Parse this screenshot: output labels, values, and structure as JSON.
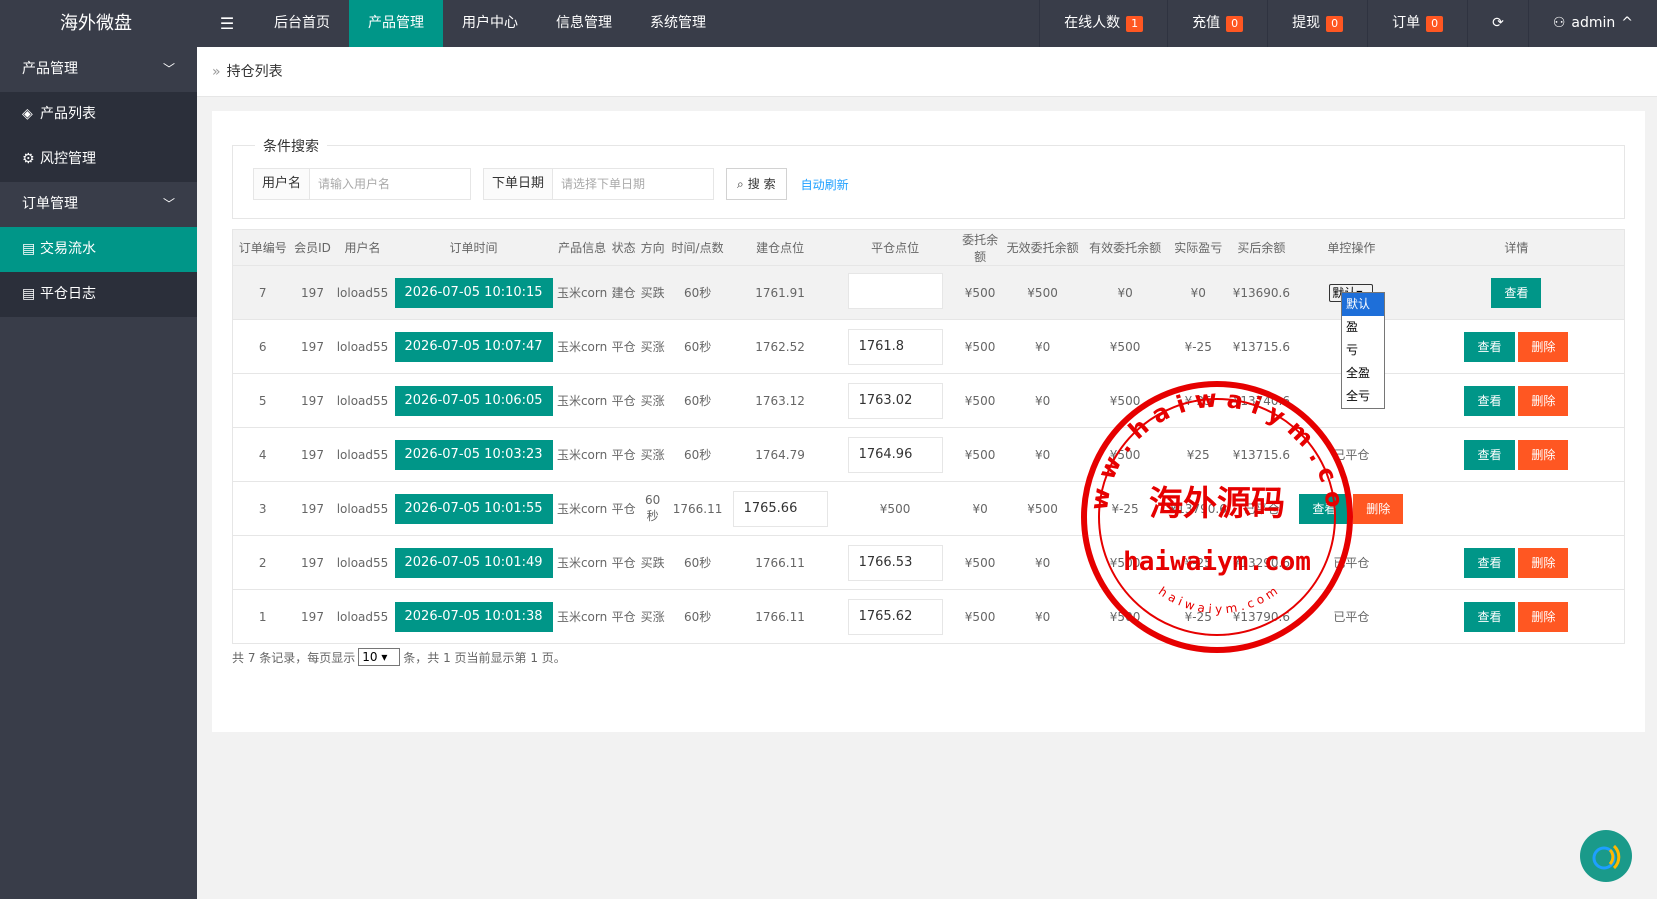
{
  "app": {
    "logo": "海外微盘",
    "menu_toggle_icon": "menu-icon"
  },
  "topnav": {
    "items": [
      {
        "label": "后台首页",
        "active": false
      },
      {
        "label": "产品管理",
        "active": true
      },
      {
        "label": "用户中心",
        "active": false
      },
      {
        "label": "信息管理",
        "active": false
      },
      {
        "label": "系统管理",
        "active": false
      }
    ]
  },
  "topright": {
    "online_label": "在线人数",
    "online_count": "1",
    "recharge_label": "充值",
    "recharge_count": "0",
    "withdraw_label": "提现",
    "withdraw_count": "0",
    "order_label": "订单",
    "order_count": "0",
    "user": "admin"
  },
  "sidebar": {
    "group1": "产品管理",
    "items1": [
      {
        "label": "产品列表",
        "icon": "layers-icon"
      },
      {
        "label": "风控管理",
        "icon": "gear-icon"
      }
    ],
    "group2": "订单管理",
    "items2": [
      {
        "label": "交易流水",
        "icon": "clipboard-icon",
        "active": true
      },
      {
        "label": "平仓日志",
        "icon": "clipboard-icon",
        "active": false
      }
    ]
  },
  "breadcrumb": {
    "label": "持仓列表"
  },
  "search": {
    "legend": "条件搜索",
    "username_label": "用户名",
    "username_placeholder": "请输入用户名",
    "date_label": "下单日期",
    "date_placeholder": "请选择下单日期",
    "search_button": "搜 索",
    "auto_refresh": "自动刷新"
  },
  "table": {
    "headers": [
      "订单编号",
      "会员ID",
      "用户名",
      "订单时间",
      "产品信息",
      "状态",
      "方向",
      "时间/点数",
      "建仓点位",
      "平仓点位",
      "委托余额",
      "无效委托余额",
      "有效委托余额",
      "实际盈亏",
      "买后余额",
      "单控操作",
      "详情"
    ],
    "rows": [
      {
        "id": "7",
        "member": "197",
        "user": "loload55",
        "time": "2026-07-05 10:10:15",
        "product": "玉米corn",
        "status": "建仓",
        "direction": "买跌",
        "dir_color": "green",
        "period": "60秒",
        "open": "1761.91",
        "close": "",
        "entrust": "¥500",
        "invalid": "¥500",
        "valid": "¥0",
        "pnl": "¥0",
        "pnl_color": "green",
        "after": "¥13690.6",
        "ctrl": "默认",
        "view": "查看",
        "del": ""
      },
      {
        "id": "6",
        "member": "197",
        "user": "loload55",
        "time": "2026-07-05 10:07:47",
        "product": "玉米corn",
        "status": "平仓",
        "direction": "买涨",
        "dir_color": "red",
        "period": "60秒",
        "open": "1762.52",
        "close": "1761.8",
        "entrust": "¥500",
        "invalid": "¥0",
        "valid": "¥500",
        "pnl": "¥-25",
        "pnl_color": "green",
        "after": "¥13715.6",
        "ctrl": "",
        "view": "查看",
        "del": "删除"
      },
      {
        "id": "5",
        "member": "197",
        "user": "loload55",
        "time": "2026-07-05 10:06:05",
        "product": "玉米corn",
        "status": "平仓",
        "direction": "买涨",
        "dir_color": "red",
        "period": "60秒",
        "open": "1763.12",
        "close": "1763.02",
        "entrust": "¥500",
        "invalid": "¥0",
        "valid": "¥500",
        "pnl": "¥-25",
        "pnl_color": "green",
        "after": "¥13740.6",
        "ctrl": "",
        "view": "查看",
        "del": "删除"
      },
      {
        "id": "4",
        "member": "197",
        "user": "loload55",
        "time": "2026-07-05 10:03:23",
        "product": "玉米corn",
        "status": "平仓",
        "direction": "买涨",
        "dir_color": "red",
        "period": "60秒",
        "open": "1764.79",
        "close": "1764.96",
        "entrust": "¥500",
        "invalid": "¥0",
        "valid": "¥500",
        "pnl": "¥25",
        "pnl_color": "red",
        "after": "¥13715.6",
        "ctrl": "已平仓",
        "view": "查看",
        "del": "删除"
      },
      {
        "id": "3",
        "member": "197",
        "user": "loload55",
        "time": "2026-07-05 10:01:55",
        "product": "玉米corn",
        "status": "平仓",
        "period": "60秒",
        "open": "1766.11",
        "close": "1765.66",
        "entrust": "¥500",
        "invalid": "¥0",
        "valid": "¥500",
        "pnl": "¥-25",
        "after": "¥13790.6",
        "ctrl": "已平仓",
        "view": "查看",
        "del": "删除"
      },
      {
        "id": "2",
        "member": "197",
        "user": "loload55",
        "time": "2026-07-05 10:01:49",
        "product": "玉米corn",
        "status": "平仓",
        "direction": "买跌",
        "dir_color": "green",
        "period": "60秒",
        "open": "1766.11",
        "close": "1766.53",
        "entrust": "¥500",
        "invalid": "¥0",
        "valid": "¥500",
        "pnl": "¥-25",
        "pnl_color": "green",
        "after": "¥13290.6",
        "ctrl": "已平仓",
        "view": "查看",
        "del": "删除"
      },
      {
        "id": "1",
        "member": "197",
        "user": "loload55",
        "time": "2026-07-05 10:01:38",
        "product": "玉米corn",
        "status": "平仓",
        "direction": "买涨",
        "dir_color": "red",
        "period": "60秒",
        "open": "1766.11",
        "close": "1765.62",
        "entrust": "¥500",
        "invalid": "¥0",
        "valid": "¥500",
        "pnl": "¥-25",
        "pnl_color": "green",
        "after": "¥13790.6",
        "ctrl": "已平仓",
        "view": "查看",
        "del": "删除"
      }
    ]
  },
  "dropdown": {
    "options": [
      "默认",
      "盈",
      "亏",
      "全盈",
      "全亏"
    ],
    "selected": "默认"
  },
  "pager": {
    "prefix": "共 7 条记录，每页显示",
    "page_size": "10",
    "suffix": "条，共 1 页当前显示第 1 页。"
  },
  "stamp": {
    "top_arc": "w w w . h a i w a i y m . c o m",
    "center": "海外源码",
    "bottom": "haiwaiym.com",
    "small": "h a i w a i y m . c o m"
  },
  "colors": {
    "accent": "#009688",
    "danger": "#ff5722",
    "sidebar": "#393d49",
    "stamp": "#e60000"
  }
}
